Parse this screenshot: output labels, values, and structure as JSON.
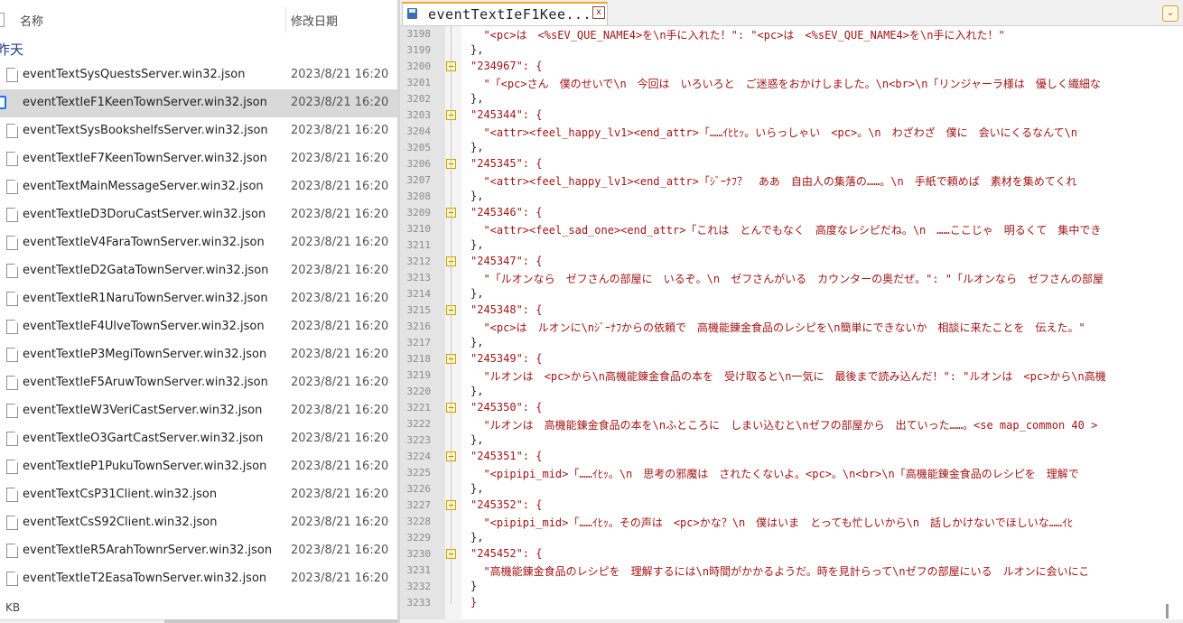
{
  "explorer": {
    "header_name": "名称",
    "header_date": "修改日期",
    "group_label": "昨天",
    "size_label": "KB",
    "files": [
      {
        "name": "eventTextSysQuestsServer.win32.json",
        "date": "2023/8/21 16:20",
        "selected": false
      },
      {
        "name": "eventTextIeF1KeenTownServer.win32.json",
        "date": "2023/8/21 16:20",
        "selected": true
      },
      {
        "name": "eventTextSysBookshelfsServer.win32.json",
        "date": "2023/8/21 16:20",
        "selected": false
      },
      {
        "name": "eventTextIeF7KeenTownServer.win32.json",
        "date": "2023/8/21 16:20",
        "selected": false
      },
      {
        "name": "eventTextMainMessageServer.win32.json",
        "date": "2023/8/21 16:20",
        "selected": false
      },
      {
        "name": "eventTextIeD3DoruCastServer.win32.json",
        "date": "2023/8/21 16:20",
        "selected": false
      },
      {
        "name": "eventTextIeV4FaraTownServer.win32.json",
        "date": "2023/8/21 16:20",
        "selected": false
      },
      {
        "name": "eventTextIeD2GataTownServer.win32.json",
        "date": "2023/8/21 16:20",
        "selected": false
      },
      {
        "name": "eventTextIeR1NaruTownServer.win32.json",
        "date": "2023/8/21 16:20",
        "selected": false
      },
      {
        "name": "eventTextIeF4UlveTownServer.win32.json",
        "date": "2023/8/21 16:20",
        "selected": false
      },
      {
        "name": "eventTextIeP3MegiTownServer.win32.json",
        "date": "2023/8/21 16:20",
        "selected": false
      },
      {
        "name": "eventTextIeF5AruwTownServer.win32.json",
        "date": "2023/8/21 16:20",
        "selected": false
      },
      {
        "name": "eventTextIeW3VeriCastServer.win32.json",
        "date": "2023/8/21 16:20",
        "selected": false
      },
      {
        "name": "eventTextIeO3GartCastServer.win32.json",
        "date": "2023/8/21 16:20",
        "selected": false
      },
      {
        "name": "eventTextIeP1PukuTownServer.win32.json",
        "date": "2023/8/21 16:20",
        "selected": false
      },
      {
        "name": "eventTextCsP31Client.win32.json",
        "date": "2023/8/21 16:20",
        "selected": false
      },
      {
        "name": "eventTextCsS92Client.win32.json",
        "date": "2023/8/21 16:20",
        "selected": false
      },
      {
        "name": "eventTextIeR5ArahTownrServer.win32.json",
        "date": "2023/8/21 16:20",
        "selected": false
      },
      {
        "name": "eventTextIeT2EasaTownServer.win32.json",
        "date": "2023/8/21 16:20",
        "selected": false
      }
    ]
  },
  "editor": {
    "tab_title": "eventTextIeF1Kee...",
    "tab_close": "x",
    "menu_glyph": "⌄",
    "lines": [
      {
        "n": "3198",
        "fold": false,
        "punct": false,
        "text": "  \"<pc>は　<%sEV_QUE_NAME4>を\\n手に入れた！\": \"<pc>は　<%sEV_QUE_NAME4>を\\n手に入れた！\""
      },
      {
        "n": "3199",
        "fold": false,
        "punct": true,
        "text": "},"
      },
      {
        "n": "3200",
        "fold": true,
        "punct": false,
        "text": "\"234967\": {"
      },
      {
        "n": "3201",
        "fold": false,
        "punct": false,
        "text": "  \"「<pc>さん　僕のせいで\\n　今回は　いろいろと　ご迷惑をおかけしました。\\n<br>\\n「リンジャーラ様は　優しく繊細な"
      },
      {
        "n": "3202",
        "fold": false,
        "punct": true,
        "text": "},"
      },
      {
        "n": "3203",
        "fold": true,
        "punct": false,
        "text": "\"245344\": {"
      },
      {
        "n": "3204",
        "fold": false,
        "punct": false,
        "text": "  \"<attr><feel_happy_lv1><end_attr>「……ｲﾋﾋｯ。いらっしゃい　<pc>。\\n　わざわざ　僕に　会いにくるなんて\\n"
      },
      {
        "n": "3205",
        "fold": false,
        "punct": true,
        "text": "},"
      },
      {
        "n": "3206",
        "fold": true,
        "punct": false,
        "text": "\"245345\": {"
      },
      {
        "n": "3207",
        "fold": false,
        "punct": false,
        "text": "  \"<attr><feel_happy_lv1><end_attr>「ｼﾞｰﾅﾌ？　ああ　自由人の集落の……。\\n　手紙で頼めば　素材を集めてくれ"
      },
      {
        "n": "3208",
        "fold": false,
        "punct": true,
        "text": "},"
      },
      {
        "n": "3209",
        "fold": true,
        "punct": false,
        "text": "\"245346\": {"
      },
      {
        "n": "3210",
        "fold": false,
        "punct": false,
        "text": "  \"<attr><feel_sad_one><end_attr>「これは　とんでもなく　高度なレシピだね。\\n　……ここじゃ　明るくて　集中でき"
      },
      {
        "n": "3211",
        "fold": false,
        "punct": true,
        "text": "},"
      },
      {
        "n": "3212",
        "fold": true,
        "punct": false,
        "text": "\"245347\": {"
      },
      {
        "n": "3213",
        "fold": false,
        "punct": false,
        "text": "  \"「ルオンなら　ゼフさんの部屋に　いるぞ。\\n　ゼフさんがいる　カウンターの奥だぜ。\": \"「ルオンなら　ゼフさんの部屋"
      },
      {
        "n": "3214",
        "fold": false,
        "punct": true,
        "text": "},"
      },
      {
        "n": "3215",
        "fold": true,
        "punct": false,
        "text": "\"245348\": {"
      },
      {
        "n": "3216",
        "fold": false,
        "punct": false,
        "text": "  \"<pc>は　ルオンに\\nｼﾞｰﾅﾌからの依頼で　高機能錬金食品のレシピを\\n簡単にできないか　相談に来たことを　伝えた。\""
      },
      {
        "n": "3217",
        "fold": false,
        "punct": true,
        "text": "},"
      },
      {
        "n": "3218",
        "fold": true,
        "punct": false,
        "text": "\"245349\": {"
      },
      {
        "n": "3219",
        "fold": false,
        "punct": false,
        "text": "  \"ルオンは　<pc>から\\n高機能錬金食品の本を　受け取ると\\n一気に　最後まで読み込んだ！\": \"ルオンは　<pc>から\\n高機"
      },
      {
        "n": "3220",
        "fold": false,
        "punct": true,
        "text": "},"
      },
      {
        "n": "3221",
        "fold": true,
        "punct": false,
        "text": "\"245350\": {"
      },
      {
        "n": "3222",
        "fold": false,
        "punct": false,
        "text": "  \"ルオンは　高機能錬金食品の本を\\nふところに　しまい込むと\\nゼフの部屋から　出ていった……。<se map_common 40 >"
      },
      {
        "n": "3223",
        "fold": false,
        "punct": true,
        "text": "},"
      },
      {
        "n": "3224",
        "fold": true,
        "punct": false,
        "text": "\"245351\": {"
      },
      {
        "n": "3225",
        "fold": false,
        "punct": false,
        "text": "  \"<pipipi_mid>「……ｲﾋｯ。\\n　思考の邪魔は　されたくないよ。<pc>。\\n<br>\\n「高機能錬金食品のレシピを　理解で"
      },
      {
        "n": "3226",
        "fold": false,
        "punct": true,
        "text": "},"
      },
      {
        "n": "3227",
        "fold": true,
        "punct": false,
        "text": "\"245352\": {"
      },
      {
        "n": "3228",
        "fold": false,
        "punct": false,
        "text": "  \"<pipipi_mid>「……ｲﾋｯ。その声は　<pc>かな？\\n　僕はいま　とっても忙しいから\\n　話しかけないでほしいな……ｲﾋ"
      },
      {
        "n": "3229",
        "fold": false,
        "punct": true,
        "text": "},"
      },
      {
        "n": "3230",
        "fold": true,
        "punct": false,
        "text": "\"245452\": {"
      },
      {
        "n": "3231",
        "fold": false,
        "punct": false,
        "text": "  \"高機能錬金食品のレシピを　理解するには\\n時間がかかるようだ。時を見計らって\\nゼフの部屋にいる　ルオンに会いにこ"
      },
      {
        "n": "3232",
        "fold": false,
        "punct": true,
        "text": "}"
      },
      {
        "n": "3233",
        "fold": false,
        "punct": false,
        "text": "}"
      }
    ]
  }
}
